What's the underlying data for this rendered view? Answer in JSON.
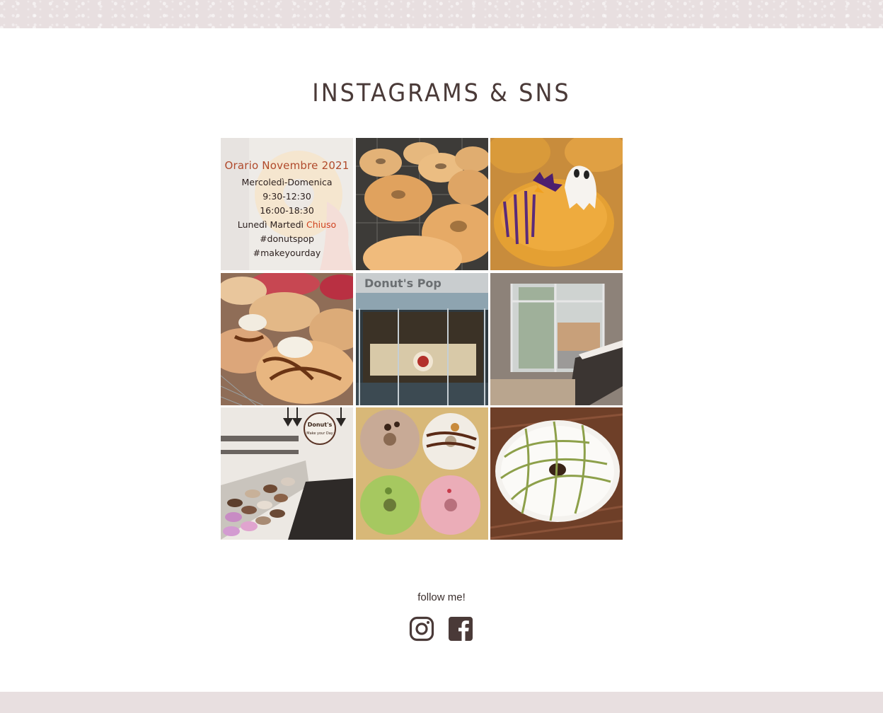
{
  "section": {
    "title": "INSTAGRAMS & SNS"
  },
  "hours_post": {
    "headline": "Orario Novembre 2021",
    "lines": [
      "Mercoledì-Domenica",
      "9:30-12:30",
      "16:00-18:30"
    ],
    "closed_prefix": "Lunedì Martedì ",
    "closed_word": "Chiuso",
    "tags": [
      "#donutspop",
      "#makeyourday"
    ]
  },
  "shop_sign": "Donut's Pop",
  "logo_text": {
    "brand": "Donut's",
    "tagline": "Make your Day"
  },
  "follow": {
    "label": "follow me!"
  },
  "social": [
    {
      "name": "instagram",
      "icon": "instagram-icon"
    },
    {
      "name": "facebook",
      "icon": "facebook-icon"
    }
  ],
  "colors": {
    "text": "#4a3a38",
    "band": "#e8dfe0",
    "accent": "#b04a2c"
  }
}
